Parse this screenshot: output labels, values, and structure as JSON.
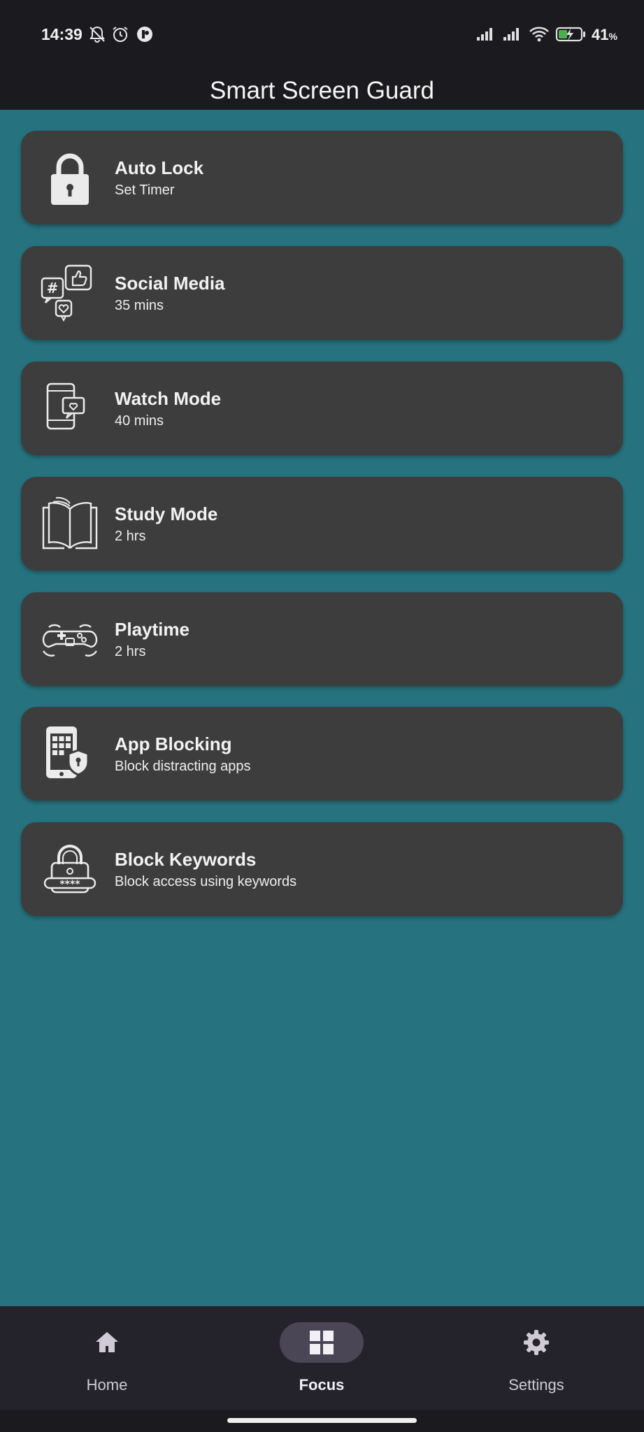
{
  "status_bar": {
    "time": "14:39",
    "battery_percent": "41",
    "battery_unit": "%",
    "battery_level": 0.41,
    "icons": [
      "bell-off-icon",
      "alarm-icon",
      "app-notification-icon",
      "signal-icon",
      "signal-icon",
      "wifi-icon",
      "battery-charging-icon"
    ]
  },
  "app": {
    "title": "Smart Screen Guard"
  },
  "cards": [
    {
      "title": "Auto Lock",
      "subtitle": "Set Timer",
      "icon": "padlock-icon"
    },
    {
      "title": "Social Media",
      "subtitle": "35 mins",
      "icon": "social-media-icon"
    },
    {
      "title": "Watch Mode",
      "subtitle": "40 mins",
      "icon": "phone-video-icon"
    },
    {
      "title": "Study Mode",
      "subtitle": "2 hrs",
      "icon": "open-book-icon"
    },
    {
      "title": "Playtime",
      "subtitle": "2 hrs",
      "icon": "gamepad-icon"
    },
    {
      "title": "App Blocking",
      "subtitle": "Block distracting apps",
      "icon": "phone-apps-lock-icon"
    },
    {
      "title": "Block Keywords",
      "subtitle": "Block access using keywords",
      "icon": "password-lock-icon"
    }
  ],
  "bottom_nav": [
    {
      "label": "Home",
      "icon": "home-icon",
      "active": false
    },
    {
      "label": "Focus",
      "icon": "grid-icon",
      "active": true
    },
    {
      "label": "Settings",
      "icon": "gear-icon",
      "active": false
    }
  ],
  "colors": {
    "background": "#26737f",
    "card": "#3d3d3d",
    "bars": "#1b1b1f",
    "nav_active_pill": "#4b4656",
    "battery_fill": "#4caf50"
  }
}
